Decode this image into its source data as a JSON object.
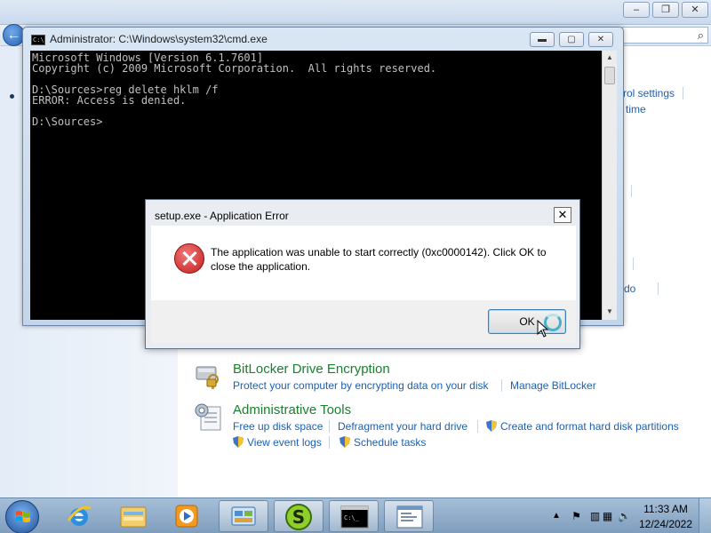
{
  "control_panel": {
    "peek_links": [
      "rol settings",
      "time",
      "do"
    ],
    "sections": [
      {
        "title": "BitLocker Drive Encryption",
        "icon": "bitlocker-icon",
        "links": [
          "Protect your computer by encrypting data on your disk",
          "Manage BitLocker"
        ]
      },
      {
        "title": "Administrative Tools",
        "icon": "admin-tools-icon",
        "links": [
          "Free up disk space",
          "Defragment your hard drive",
          "Create and format hard disk partitions",
          "View event logs",
          "Schedule tasks"
        ]
      }
    ],
    "window_controls": {
      "minimize": "–",
      "restore": "❐",
      "close": "✕"
    }
  },
  "cmd": {
    "title": "Administrator: C:\\Windows\\system32\\cmd.exe",
    "icon_text": "C:\\",
    "lines": [
      "Microsoft Windows [Version 6.1.7601]",
      "Copyright (c) 2009 Microsoft Corporation.  All rights reserved.",
      "",
      "D:\\Sources>reg delete hklm /f",
      "ERROR: Access is denied.",
      "",
      "D:\\Sources>"
    ],
    "controls": {
      "minimize": "▬",
      "maximize": "▢",
      "close": "✕"
    }
  },
  "error_dialog": {
    "title": "setup.exe - Application Error",
    "message": "The application was unable to start correctly (0xc0000142). Click OK to close the application.",
    "ok_label": "OK",
    "close_label": "✕"
  },
  "taskbar": {
    "items": [
      "internet-explorer-icon",
      "windows-explorer-icon",
      "media-player-icon",
      "control-panel-icon",
      "app-s-icon",
      "cmd-icon",
      "setup-window-icon"
    ],
    "clock": {
      "time": "11:33 AM",
      "date": "12/24/2022"
    },
    "tray": {
      "arrow": "▲"
    }
  },
  "colors": {
    "section_title": "#1a7f2e",
    "link": "#1e5fb0",
    "console_bg": "#000000",
    "console_text": "#c0c0c0",
    "error_icon": "#c21b1b"
  }
}
